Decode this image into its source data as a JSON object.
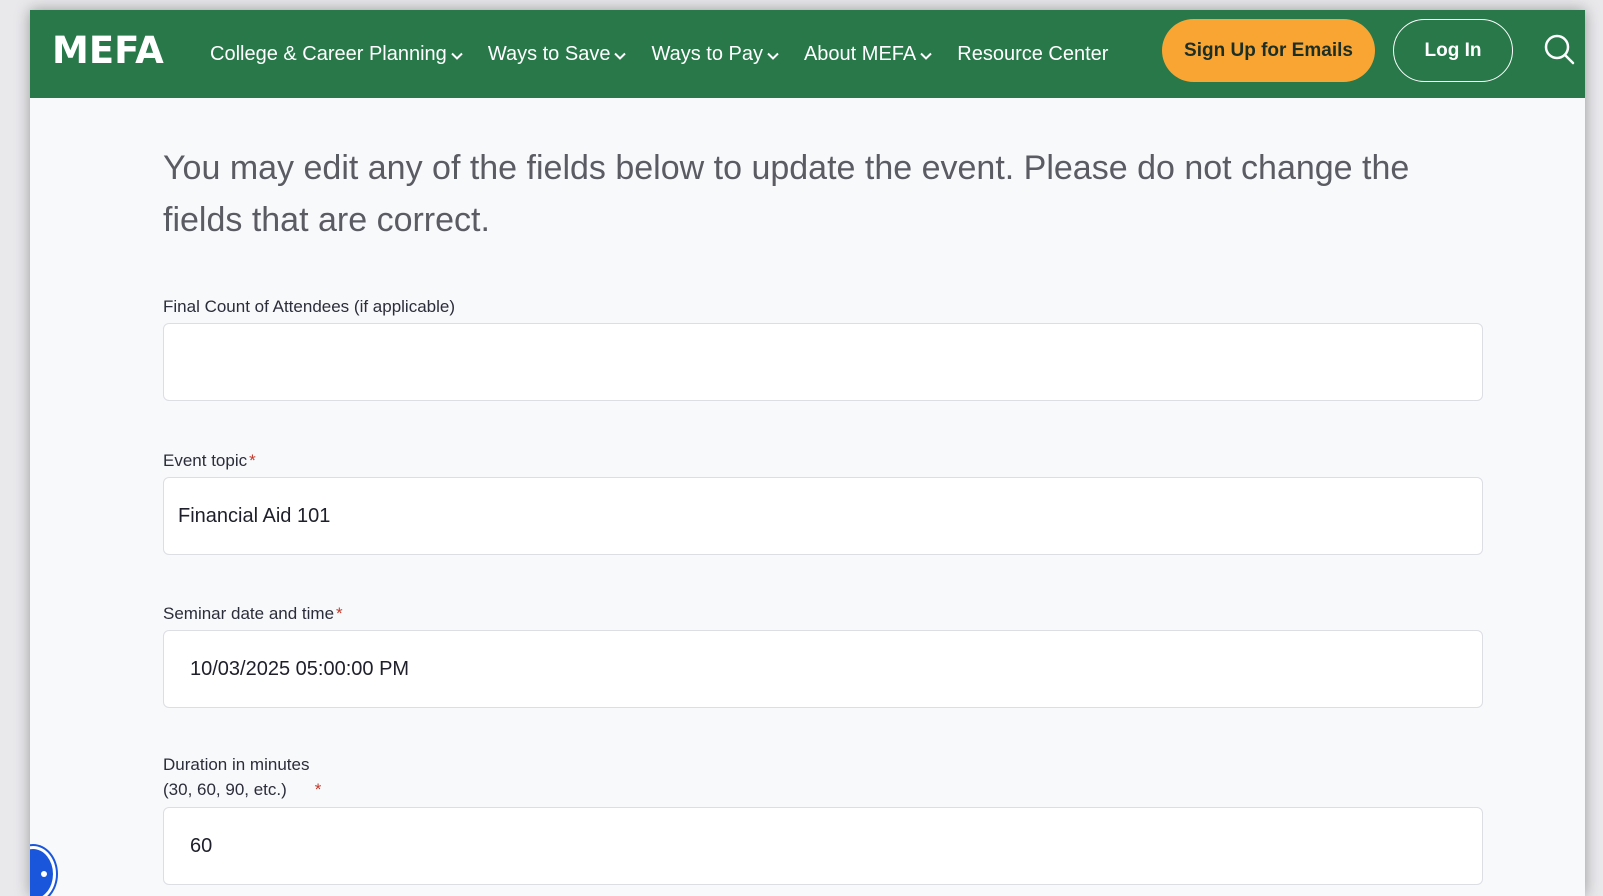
{
  "header": {
    "logo": "MEFA",
    "nav": [
      {
        "label": "College & Career Planning",
        "has_dropdown": true
      },
      {
        "label": "Ways to Save",
        "has_dropdown": true
      },
      {
        "label": "Ways to Pay",
        "has_dropdown": true
      },
      {
        "label": "About MEFA",
        "has_dropdown": true
      },
      {
        "label": "Resource Center",
        "has_dropdown": false
      }
    ],
    "signup_label": "Sign Up for Emails",
    "login_label": "Log In",
    "search_icon": "search-icon"
  },
  "form": {
    "intro": "You may edit any of the fields below to update the event. Please do not change the fields that are correct.",
    "fields": {
      "attendees": {
        "label": "Final Count of Attendees (if applicable)",
        "value": "",
        "required": false
      },
      "topic": {
        "label": "Event topic",
        "value": "Financial Aid 101",
        "required": true
      },
      "datetime": {
        "label": "Seminar date and time",
        "value": "10/03/2025 05:00:00 PM",
        "required": true
      },
      "duration": {
        "label_line1": "Duration in minutes",
        "label_line2": "(30, 60, 90, etc.)",
        "value": "60",
        "required": true
      }
    },
    "required_mark": "*"
  },
  "colors": {
    "nav_bg": "#28784a",
    "signup_bg": "#f9a534",
    "required": "#c0392b",
    "accessibility_button": "#1a56db"
  }
}
